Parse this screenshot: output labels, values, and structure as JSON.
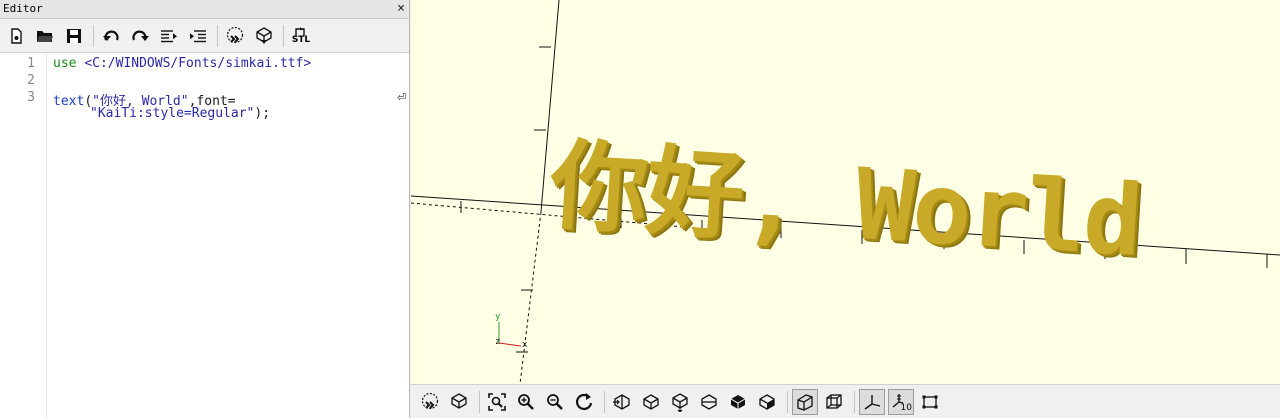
{
  "editor": {
    "title": "Editor",
    "close_label": "×",
    "toolbar": [
      "new-file-icon",
      "open-file-icon",
      "save-icon",
      "undo-icon",
      "redo-icon",
      "unindent-icon",
      "indent-icon",
      "preview-icon",
      "render-icon",
      "export-stl-icon"
    ],
    "stl_label": "STL",
    "line_numbers": [
      "1",
      "2",
      "3"
    ],
    "lines": {
      "l1_kw": "use",
      "l1_path": "<C:/WINDOWS/Fonts/simkai.ttf>",
      "l3_fn": "text",
      "l3_open": "(",
      "l3_str": "\"你好, World\"",
      "l3_rest": ",font=",
      "l3b_str": "\"KaiTi:style=Regular\"",
      "l3b_close": ");"
    },
    "wrap_marker": "⏎"
  },
  "viewport": {
    "text": "你好, World",
    "text_color": "#c8aa28",
    "axis_labels": {
      "y": "y",
      "z": "z",
      "x": "x"
    }
  },
  "view_toolbar": {
    "buttons": [
      "preview",
      "render",
      "view-all",
      "zoom-in",
      "zoom-out",
      "reset-view",
      "view-right",
      "view-top",
      "view-bottom",
      "view-left",
      "view-front",
      "view-back",
      "perspective",
      "orthogonal",
      "show-axes",
      "show-scale-markers",
      "show-edges"
    ],
    "scale_label": "10",
    "colors": {
      "accent": "#d11a1a"
    }
  }
}
